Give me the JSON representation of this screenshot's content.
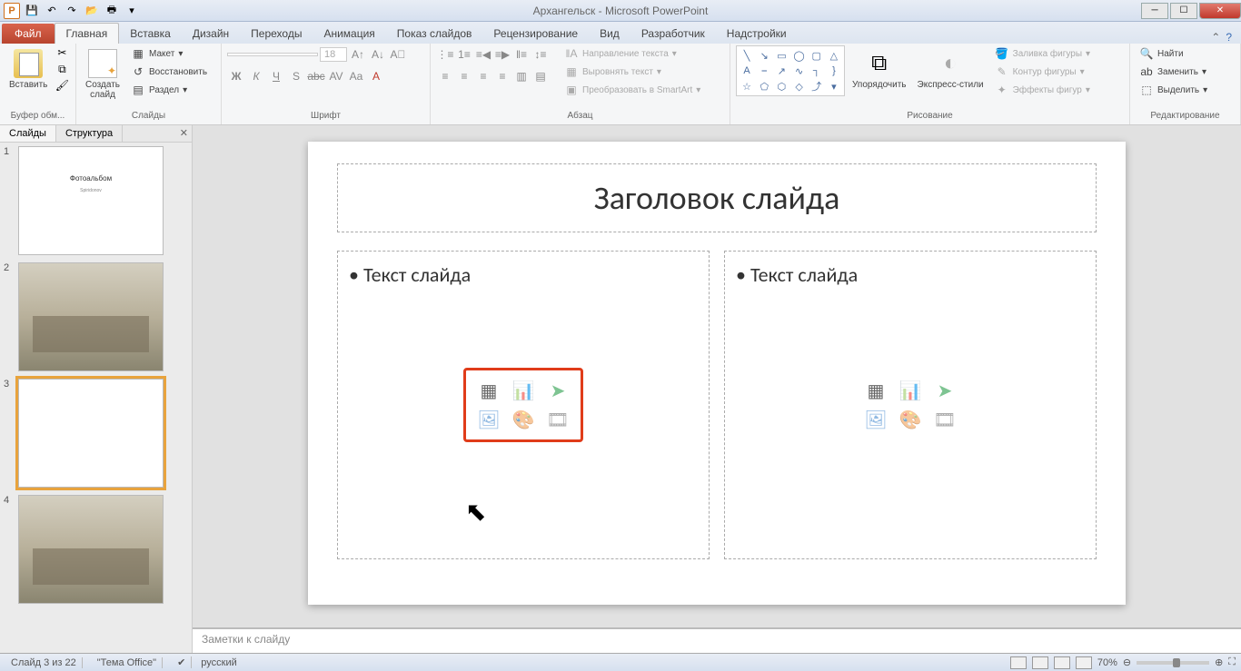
{
  "titlebar": {
    "app_icon": "P",
    "title": "Архангельск - Microsoft PowerPoint"
  },
  "ribbon": {
    "file": "Файл",
    "tabs": [
      "Главная",
      "Вставка",
      "Дизайн",
      "Переходы",
      "Анимация",
      "Показ слайдов",
      "Рецензирование",
      "Вид",
      "Разработчик",
      "Надстройки"
    ],
    "active_tab": 0,
    "groups": {
      "clipboard": {
        "label": "Буфер обм...",
        "paste": "Вставить"
      },
      "slides": {
        "label": "Слайды",
        "new": "Создать\nслайд",
        "layout": "Макет",
        "reset": "Восстановить",
        "section": "Раздел"
      },
      "font": {
        "label": "Шрифт",
        "size": "18",
        "buttons": [
          "Ж",
          "К",
          "Ч",
          "S",
          "abc",
          "AV",
          "Aa",
          "A"
        ]
      },
      "paragraph": {
        "label": "Абзац",
        "dir": "Направление текста",
        "align": "Выровнять текст",
        "smart": "Преобразовать в SmartArt"
      },
      "drawing": {
        "label": "Рисование",
        "arrange": "Упорядочить",
        "styles": "Экспресс-стили",
        "fill": "Заливка фигуры",
        "outline": "Контур фигуры",
        "effects": "Эффекты фигур"
      },
      "editing": {
        "label": "Редактирование",
        "find": "Найти",
        "replace": "Заменить",
        "select": "Выделить"
      }
    }
  },
  "side": {
    "tabs": [
      "Слайды",
      "Структура"
    ],
    "thumbs": [
      {
        "n": "1",
        "title": "Фотоальбом",
        "sub": "Spiridonov"
      },
      {
        "n": "2"
      },
      {
        "n": "3"
      },
      {
        "n": "4"
      }
    ]
  },
  "slide": {
    "title": "Заголовок слайда",
    "body_left": "Текст слайда",
    "body_right": "Текст слайда"
  },
  "notes": {
    "placeholder": "Заметки к слайду"
  },
  "status": {
    "slide": "Слайд 3 из 22",
    "theme": "\"Тема Office\"",
    "lang": "русский",
    "zoom": "70%"
  }
}
